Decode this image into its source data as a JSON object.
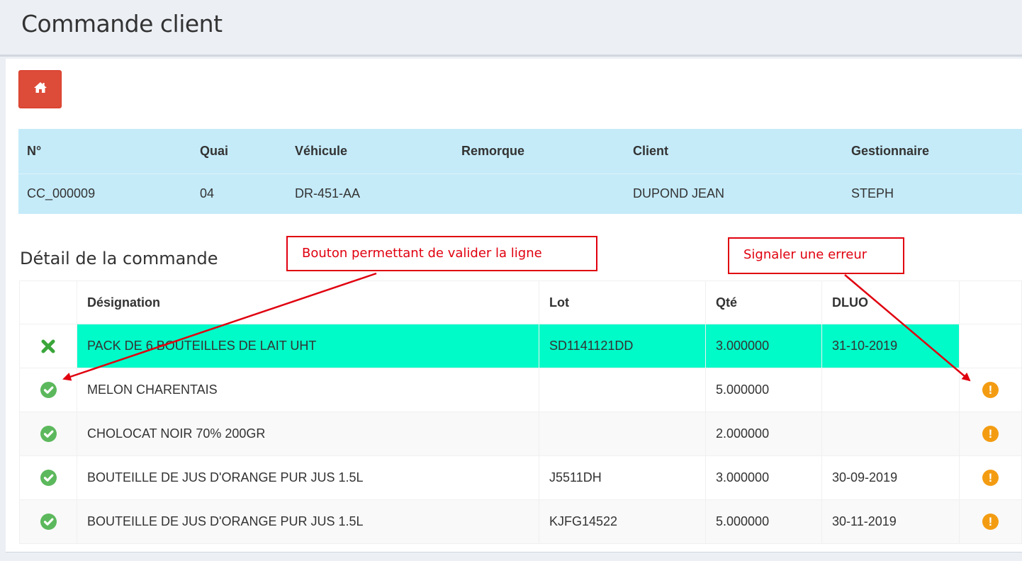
{
  "page": {
    "title": "Commande client"
  },
  "order": {
    "headers": [
      "N°",
      "Quai",
      "Véhicule",
      "Remorque",
      "Client",
      "Gestionnaire"
    ],
    "values": [
      "CC_000009",
      "04",
      "DR-451-AA",
      "",
      "DUPOND JEAN",
      "STEPH"
    ]
  },
  "detail": {
    "title": "Détail de la commande",
    "headers": [
      "",
      "Désignation",
      "Lot",
      "Qté",
      "DLUO",
      ""
    ],
    "rows": [
      {
        "status": "cancel",
        "designation": "PACK DE 6 BOUTEILLES DE LAIT UHT",
        "lot": "SD1141121DD",
        "qte": "3.000000",
        "dluo": "31-10-2019",
        "error": false
      },
      {
        "status": "validate",
        "designation": "MELON CHARENTAIS",
        "lot": "",
        "qte": "5.000000",
        "dluo": "",
        "error": true
      },
      {
        "status": "validate",
        "designation": "CHOLOCAT NOIR 70% 200GR",
        "lot": "",
        "qte": "2.000000",
        "dluo": "",
        "error": true
      },
      {
        "status": "validate",
        "designation": "BOUTEILLE DE JUS D'ORANGE PUR JUS 1.5L",
        "lot": "J5511DH",
        "qte": "3.000000",
        "dluo": "30-09-2019",
        "error": true
      },
      {
        "status": "validate",
        "designation": "BOUTEILLE DE JUS D'ORANGE PUR JUS 1.5L",
        "lot": "KJFG14522",
        "qte": "5.000000",
        "dluo": "30-11-2019",
        "error": true
      }
    ]
  },
  "annotations": {
    "validate": "Bouton permettant de valider la ligne",
    "error": "Signaler une erreur"
  },
  "icons": {
    "home": "home-icon",
    "validate": "check-circle-icon",
    "cancel": "times-icon",
    "error": "exclamation-circle-icon"
  },
  "colors": {
    "home_button": "#dd4b39",
    "info_bg": "#c5ebf9",
    "active_row": "#00fac8",
    "validate": "#5cb85c",
    "error": "#f39c12",
    "annotation": "#e0000f"
  }
}
